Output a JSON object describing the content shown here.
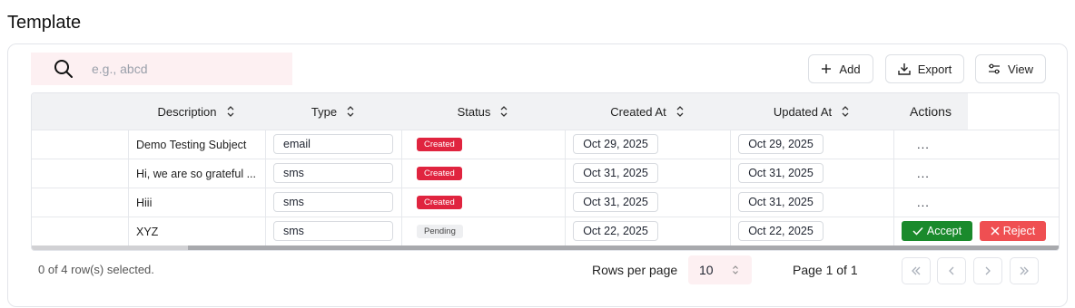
{
  "page": {
    "title": "Template"
  },
  "search": {
    "placeholder": "e.g., abcd",
    "value": ""
  },
  "toolbar": {
    "add_label": "Add",
    "export_label": "Export",
    "view_label": "View"
  },
  "columns": {
    "description": "Description",
    "type": "Type",
    "status": "Status",
    "created_at": "Created At",
    "updated_at": "Updated At",
    "actions": "Actions"
  },
  "rows": [
    {
      "description": "Demo Testing Subject",
      "type": "email",
      "status": "Created",
      "created_at": "Oct 29, 2025",
      "updated_at": "Oct 29, 2025",
      "actions": "..."
    },
    {
      "description": "Hi, we are so grateful ...",
      "type": "sms",
      "status": "Created",
      "created_at": "Oct 31, 2025",
      "updated_at": "Oct 31, 2025",
      "actions": "..."
    },
    {
      "description": "Hiii",
      "type": "sms",
      "status": "Created",
      "created_at": "Oct 31, 2025",
      "updated_at": "Oct 31, 2025",
      "actions": "..."
    },
    {
      "description": "XYZ",
      "type": "sms",
      "status": "Pending",
      "created_at": "Oct 22, 2025",
      "updated_at": "Oct 22, 2025",
      "accept_label": "Accept",
      "reject_label": "Reject"
    }
  ],
  "footer": {
    "selection_text": "0 of 4 row(s) selected.",
    "rows_per_page_label": "Rows per page",
    "rows_per_page_value": "10",
    "page_info": "Page 1 of 1"
  },
  "icons": {
    "search": "search-icon",
    "add": "plus-icon",
    "export": "download-icon",
    "view": "sliders-icon",
    "sort": "sort-icon",
    "accept": "check-icon",
    "reject": "x-icon",
    "first_page": "chevrons-left-icon",
    "prev_page": "chevron-left-icon",
    "next_page": "chevron-right-icon",
    "last_page": "chevrons-right-icon"
  },
  "colors": {
    "created_badge": "#e0243f",
    "pending_badge": "#eeeff1",
    "accept": "#1a8a2c",
    "reject": "#ef4f52",
    "search_bg": "#fdf0f2"
  }
}
